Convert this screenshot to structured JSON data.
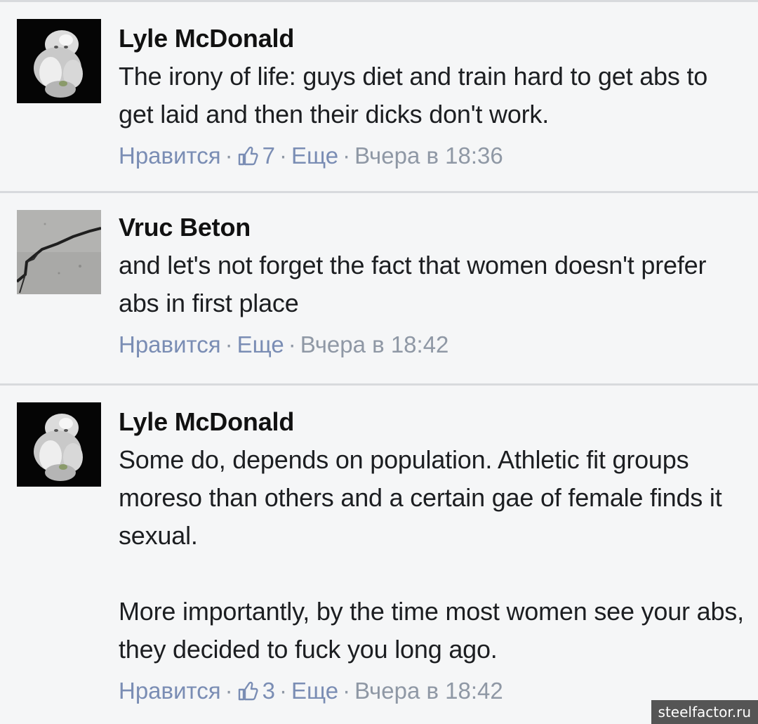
{
  "comments": [
    {
      "author": "Lyle McDonald",
      "avatar": "white-gorilla-avatar",
      "paragraphs": [
        "The irony of life: guys diet and train hard to get abs to get laid and then their dicks don't work."
      ],
      "like_label": "Нравится",
      "likes": "7",
      "more_label": "Еще",
      "timestamp": "Вчера в 18:36"
    },
    {
      "author": "Vruc Beton",
      "avatar": "cracked-concrete-avatar",
      "paragraphs": [
        "and let's not forget the fact that women doesn't prefer abs in first place"
      ],
      "like_label": "Нравится",
      "more_label": "Еще",
      "timestamp": "Вчера в 18:42"
    },
    {
      "author": "Lyle McDonald",
      "avatar": "white-gorilla-avatar",
      "paragraphs": [
        "Some do, depends on population. Athletic fit groups moreso than others and a certain gae of female finds it sexual.",
        "More importantly, by the time most women see your abs, they decided to fuck you long ago."
      ],
      "like_label": "Нравится",
      "likes": "3",
      "more_label": "Еще",
      "timestamp": "Вчера в 18:42"
    }
  ],
  "separator": "·",
  "watermark": "steelfactor.ru",
  "colors": {
    "background": "#f5f6f7",
    "divider": "#d8dadd",
    "link": "#7a8db4",
    "meta": "#8f98a5",
    "text": "#1c1e21"
  }
}
